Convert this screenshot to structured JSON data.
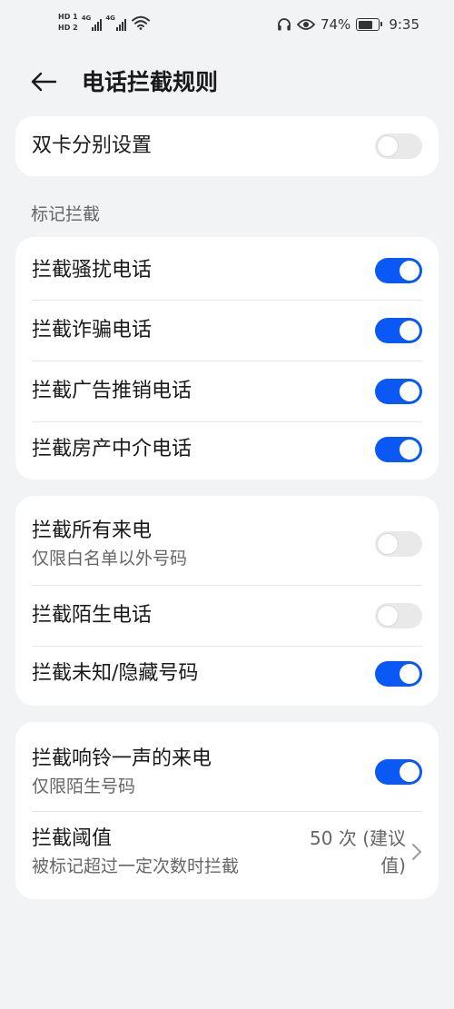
{
  "status_bar": {
    "sim1": "HD 1",
    "sim2": "HD 2",
    "net1": "4G",
    "net2": "4G",
    "battery_percent": "74%",
    "battery_level": 0.74,
    "time": "9:35"
  },
  "header": {
    "title": "电话拦截规则"
  },
  "dual_sim": {
    "label": "双卡分别设置",
    "enabled": false
  },
  "section_marked": {
    "label": "标记拦截"
  },
  "marked_items": [
    {
      "label": "拦截骚扰电话",
      "enabled": true
    },
    {
      "label": "拦截诈骗电话",
      "enabled": true
    },
    {
      "label": "拦截广告推销电话",
      "enabled": true
    },
    {
      "label": "拦截房产中介电话",
      "enabled": true
    }
  ],
  "call_filters": [
    {
      "label": "拦截所有来电",
      "sub": "仅限白名单以外号码",
      "enabled": false
    },
    {
      "label": "拦截陌生电话",
      "enabled": false
    },
    {
      "label": "拦截未知/隐藏号码",
      "enabled": true
    }
  ],
  "ring_once": {
    "label": "拦截响铃一声的来电",
    "sub": "仅限陌生号码",
    "enabled": true
  },
  "threshold": {
    "label": "拦截阈值",
    "sub": "被标记超过一定次数时拦截",
    "value": "50 次 (建议值)"
  },
  "colors": {
    "accent": "#0a59f7",
    "background": "#f1f3f5",
    "card": "#ffffff",
    "secondary_text": "#666666"
  },
  "icons": {
    "back": "arrow-left-icon",
    "headphones": "headphones-icon",
    "eye": "eye-icon",
    "wifi": "wifi-icon",
    "chevron": "chevron-right-icon"
  }
}
